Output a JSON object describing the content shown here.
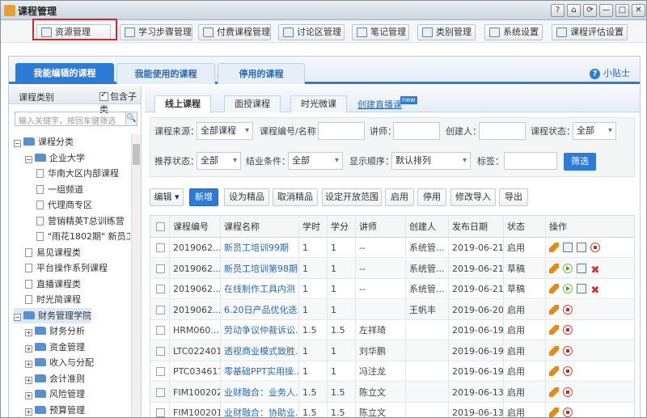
{
  "window": {
    "title": "课程管理",
    "controls": [
      "?",
      "⌂",
      "⟳",
      "—",
      "□",
      "✕"
    ]
  },
  "toolbar": {
    "buttons": [
      {
        "label": "资源管理",
        "icon": "resource-icon"
      },
      {
        "label": "学习步骤管理",
        "icon": "steps-icon"
      },
      {
        "label": "付费课程管理",
        "icon": "paid-course-icon"
      },
      {
        "label": "讨论区管理",
        "icon": "discussion-icon"
      },
      {
        "label": "笔记管理",
        "icon": "notes-icon"
      },
      {
        "label": "类别管理",
        "icon": "category-icon"
      },
      {
        "label": "系统设置",
        "icon": "settings-icon"
      },
      {
        "label": "课程评估设置",
        "icon": "evaluation-icon"
      }
    ]
  },
  "main_tabs": [
    {
      "label": "我能编辑的课程",
      "active": true
    },
    {
      "label": "我能使用的课程",
      "active": false
    },
    {
      "label": "停用的课程",
      "active": false
    }
  ],
  "tips": {
    "label": "小贴士"
  },
  "sidebar": {
    "title": "课程类别",
    "include_sub_label": "包含子类",
    "include_sub_checked": true,
    "search_placeholder": "输入关键字，按回车键筛选",
    "tree": [
      {
        "label": "课程分类",
        "type": "folder",
        "expand": "−",
        "level": 0
      },
      {
        "label": "企业大学",
        "type": "folder",
        "expand": "−",
        "level": 1
      },
      {
        "label": "华南大区内部课程",
        "type": "doc",
        "level": 2
      },
      {
        "label": "一组频道",
        "type": "doc",
        "level": 2
      },
      {
        "label": "代理商专区",
        "type": "doc",
        "level": 2
      },
      {
        "label": "营销精英T总训练营",
        "type": "doc",
        "level": 2
      },
      {
        "label": "\"雨花1802期\" 新员工",
        "type": "doc",
        "level": 2
      },
      {
        "label": "易见课程类",
        "type": "doc",
        "level": 1
      },
      {
        "label": "平台操作系列课程",
        "type": "doc",
        "level": 1
      },
      {
        "label": "直播课程类",
        "type": "doc",
        "level": 1
      },
      {
        "label": "时光简课程",
        "type": "doc",
        "level": 1
      },
      {
        "label": "财务管理学院",
        "type": "folder",
        "expand": "−",
        "level": 0,
        "selected": true
      },
      {
        "label": "财务分析",
        "type": "folder",
        "expand": "+",
        "level": 1
      },
      {
        "label": "资金管理",
        "type": "folder",
        "expand": "+",
        "level": 1
      },
      {
        "label": "收入与分配",
        "type": "folder",
        "expand": "+",
        "level": 1
      },
      {
        "label": "会计准则",
        "type": "folder",
        "expand": "+",
        "level": 1
      },
      {
        "label": "风险管理",
        "type": "folder",
        "expand": "+",
        "level": 1
      },
      {
        "label": "预算管理",
        "type": "folder",
        "expand": "+",
        "level": 1
      }
    ]
  },
  "sub_tabs": [
    {
      "label": "线上课程",
      "active": true
    },
    {
      "label": "面授课程",
      "active": false
    },
    {
      "label": "时光微课",
      "active": false
    }
  ],
  "create_link": {
    "label": "创建直播课",
    "badge": "new"
  },
  "filters": {
    "source_label": "课程来源：",
    "source_value": "全部课程",
    "code_label": "课程编号/名称：",
    "lecturer_label": "讲师：",
    "creator_label": "创建人：",
    "status_label": "课程状态：",
    "status_value": "全部",
    "recommend_label": "推荐状态：",
    "recommend_value": "全部",
    "completion_label": "结业条件：",
    "completion_value": "全部",
    "order_label": "显示顺序：",
    "order_value": "默认排列",
    "tag_label": "标签：",
    "filter_button": "筛选"
  },
  "actions": {
    "edit": "编辑",
    "new": "新增",
    "set_featured": "设为精品",
    "cancel_featured": "取消精品",
    "set_scope": "设定开放范围",
    "enable": "启用",
    "disable": "停用",
    "modify_import": "修改导入",
    "export": "导出"
  },
  "table": {
    "columns": [
      "课程编号",
      "课程名称",
      "学时",
      "学分",
      "讲师",
      "创建人",
      "发布日期",
      "状态",
      "操作"
    ],
    "rows": [
      {
        "code": "2019062...",
        "name": "新员工培训99期",
        "hours": "1",
        "credits": "1",
        "lecturer": "--",
        "creator": "系统管...",
        "date": "2019-06-21",
        "status": "启用",
        "ops": [
          "pen",
          "copy",
          "copy2",
          "stop"
        ]
      },
      {
        "code": "2019062...",
        "name": "新员工培训第98期",
        "hours": "1",
        "credits": "1",
        "lecturer": "--",
        "creator": "系统管...",
        "date": "2019-06-21",
        "status": "草稿",
        "ops": [
          "pen",
          "play",
          "copy",
          "del"
        ]
      },
      {
        "code": "2019062...",
        "name": "在线制作工具内测",
        "hours": "1",
        "credits": "1",
        "lecturer": "--",
        "creator": "系统管...",
        "date": "2019-06-21",
        "status": "草稿",
        "ops": [
          "pen",
          "play",
          "copy",
          "del"
        ]
      },
      {
        "code": "2019062...",
        "name": "6.20日产品优化迭...",
        "hours": "1",
        "credits": "1",
        "lecturer": "",
        "creator": "王帆丰",
        "date": "2019-06-20",
        "status": "启用",
        "ops": [
          "pen",
          "stop"
        ]
      },
      {
        "code": "HRM060...",
        "name": "劳动争议仲裁诉讼...",
        "hours": "1.5",
        "credits": "1.5",
        "lecturer": "左祥琦",
        "creator": "",
        "date": "2019-06-19",
        "status": "启用",
        "ops": [
          "pen",
          "stop"
        ]
      },
      {
        "code": "LTC022401",
        "name": "透视商业模式致胜...",
        "hours": "1",
        "credits": "1",
        "lecturer": "刘华鹏",
        "creator": "",
        "date": "2019-06-19",
        "status": "启用",
        "ops": [
          "pen",
          "stop"
        ]
      },
      {
        "code": "PTC034617",
        "name": "零基础PPT实用操...",
        "hours": "1",
        "credits": "1",
        "lecturer": "冯注龙",
        "creator": "",
        "date": "2019-06-19",
        "status": "启用",
        "ops": [
          "pen",
          "stop"
        ]
      },
      {
        "code": "FIM100202",
        "name": "业财融合：业务人...",
        "hours": "1.5",
        "credits": "1.5",
        "lecturer": "陈立文",
        "creator": "",
        "date": "2019-06-13",
        "status": "启用",
        "ops": [
          "pen",
          "stop"
        ]
      },
      {
        "code": "FIM100201",
        "name": "业财融合：协助业...",
        "hours": "1.5",
        "credits": "1.5",
        "lecturer": "陈立文",
        "creator": "",
        "date": "2019-06-13",
        "status": "启用",
        "ops": [
          "pen",
          "stop"
        ]
      }
    ]
  }
}
